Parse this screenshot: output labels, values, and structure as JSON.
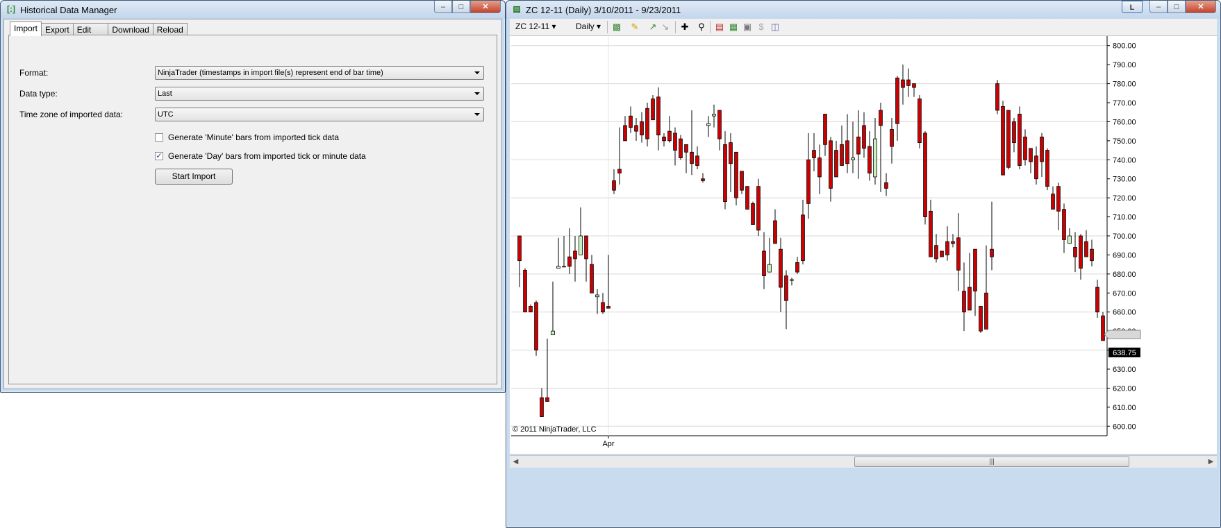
{
  "hdm": {
    "title": "Historical Data Manager",
    "tabs": [
      "Import",
      "Export",
      "Edit",
      "Download",
      "Reload"
    ],
    "format_label": "Format:",
    "format_value": "NinjaTrader (timestamps in import file(s) represent end of bar time)",
    "datatype_label": "Data type:",
    "datatype_value": "Last",
    "timezone_label": "Time zone of imported data:",
    "timezone_value": "UTC",
    "gen_minute_label": "Generate 'Minute' bars from imported tick data",
    "gen_minute_checked": false,
    "gen_day_label": "Generate 'Day' bars from imported tick or minute data",
    "gen_day_checked": true,
    "start_button": "Start Import"
  },
  "chart_window": {
    "title": "ZC 12-11 (Daily)  3/10/2011 - 9/23/2011",
    "link_button": "L",
    "toolbar": {
      "instrument": "ZC 12-11",
      "interval": "Daily"
    },
    "copyright": "© 2011 NinjaTrader, LLC"
  },
  "chart_data": {
    "type": "candlestick",
    "title": "ZC 12-11 (Daily)",
    "ylim": [
      595,
      805
    ],
    "y_ticks": [
      "800.00",
      "790.00",
      "780.00",
      "770.00",
      "760.00",
      "750.00",
      "740.00",
      "730.00",
      "720.00",
      "710.00",
      "700.00",
      "690.00",
      "680.00",
      "670.00",
      "660.00",
      "650.00",
      "640.00",
      "630.00",
      "620.00",
      "610.00",
      "600.00"
    ],
    "y_tick_values": [
      800,
      790,
      780,
      770,
      760,
      750,
      740,
      730,
      720,
      710,
      700,
      690,
      680,
      670,
      660,
      650,
      640,
      630,
      620,
      610,
      600
    ],
    "x_labels": [
      {
        "label": "Apr",
        "index": 16
      }
    ],
    "last_price": "638.75",
    "last_price_value": 638.75,
    "colors": {
      "up": "#c8f0c0",
      "down": "#cc0000",
      "outline": "#000000"
    },
    "candles": [
      [
        700,
        700,
        687,
        673
      ],
      [
        682,
        683,
        660,
        665
      ],
      [
        663,
        664,
        660,
        663
      ],
      [
        665,
        666,
        640,
        637
      ],
      [
        615,
        620,
        605,
        610
      ],
      [
        615,
        646,
        613,
        646
      ],
      [
        648,
        676,
        650,
        684
      ],
      [
        683,
        699,
        684,
        684
      ],
      [
        684,
        700,
        684,
        685
      ],
      [
        689,
        704,
        684,
        680
      ],
      [
        692,
        700,
        688,
        676
      ],
      [
        690,
        715,
        700,
        700
      ],
      [
        700,
        700,
        688,
        676
      ],
      [
        685,
        690,
        670,
        681
      ],
      [
        668,
        672,
        669,
        659
      ],
      [
        665,
        670,
        660,
        659
      ],
      [
        663,
        690,
        662,
        662
      ],
      [
        729,
        735,
        724,
        722
      ],
      [
        735,
        757,
        733,
        727
      ],
      [
        758,
        763,
        750,
        753
      ],
      [
        763,
        768,
        757,
        754
      ],
      [
        758,
        762,
        755,
        750
      ],
      [
        760,
        765,
        753,
        749
      ],
      [
        767,
        770,
        751,
        747
      ],
      [
        772,
        774,
        761,
        771
      ],
      [
        773,
        778,
        753,
        745
      ],
      [
        752,
        754,
        750,
        747
      ],
      [
        755,
        763,
        750,
        749
      ],
      [
        754,
        757,
        745,
        737
      ],
      [
        751,
        753,
        741,
        740
      ],
      [
        748,
        748,
        744,
        733
      ],
      [
        744,
        766,
        738,
        732
      ],
      [
        742,
        747,
        737,
        735
      ],
      [
        730,
        733,
        729,
        728
      ],
      [
        758,
        763,
        759,
        752
      ],
      [
        763,
        769,
        764,
        757
      ],
      [
        766,
        766,
        751,
        745
      ],
      [
        748,
        755,
        718,
        714
      ],
      [
        749,
        754,
        738,
        723
      ],
      [
        744,
        743,
        720,
        716
      ],
      [
        734,
        734,
        724,
        722
      ],
      [
        726,
        726,
        714,
        716
      ],
      [
        717,
        718,
        706,
        710
      ],
      [
        726,
        730,
        703,
        700
      ],
      [
        692,
        702,
        679,
        672
      ],
      [
        681,
        699,
        685,
        684
      ],
      [
        708,
        714,
        696,
        698
      ],
      [
        693,
        699,
        673,
        660
      ],
      [
        679,
        682,
        666,
        651
      ],
      [
        677,
        678,
        677,
        674
      ],
      [
        686,
        689,
        681,
        680
      ],
      [
        711,
        719,
        687,
        685
      ],
      [
        740,
        754,
        717,
        709
      ],
      [
        745,
        754,
        741,
        734
      ],
      [
        741,
        748,
        731,
        722
      ],
      [
        764,
        763,
        748,
        742
      ],
      [
        750,
        752,
        725,
        718
      ],
      [
        745,
        750,
        731,
        733
      ],
      [
        748,
        758,
        737,
        741
      ],
      [
        750,
        764,
        738,
        733
      ],
      [
        740,
        760,
        741,
        733
      ],
      [
        752,
        766,
        743,
        730
      ],
      [
        758,
        765,
        746,
        741
      ],
      [
        747,
        755,
        733,
        729
      ],
      [
        731,
        762,
        751,
        727
      ],
      [
        766,
        770,
        758,
        723
      ],
      [
        728,
        733,
        725,
        721
      ],
      [
        756,
        762,
        747,
        738
      ],
      [
        783,
        784,
        759,
        750
      ],
      [
        782,
        790,
        778,
        769
      ],
      [
        782,
        788,
        779,
        773
      ],
      [
        780,
        780,
        778,
        773
      ],
      [
        772,
        774,
        749,
        746
      ],
      [
        754,
        755,
        710,
        706
      ],
      [
        713,
        719,
        689,
        689
      ],
      [
        695,
        701,
        688,
        686
      ],
      [
        692,
        692,
        689,
        690
      ],
      [
        697,
        705,
        690,
        687
      ],
      [
        697,
        701,
        696,
        694
      ],
      [
        699,
        712,
        682,
        671
      ],
      [
        671,
        686,
        660,
        650
      ],
      [
        673,
        691,
        661,
        672
      ],
      [
        693,
        691,
        671,
        658
      ],
      [
        663,
        660,
        650,
        649
      ],
      [
        670,
        695,
        651,
        678
      ],
      [
        693,
        718,
        689,
        682
      ],
      [
        780,
        782,
        766,
        764
      ],
      [
        768,
        771,
        732,
        734
      ],
      [
        766,
        765,
        736,
        735
      ],
      [
        760,
        762,
        749,
        744
      ],
      [
        764,
        768,
        737,
        735
      ],
      [
        752,
        756,
        740,
        737
      ],
      [
        746,
        746,
        739,
        733
      ],
      [
        742,
        747,
        730,
        727
      ],
      [
        752,
        754,
        739,
        731
      ],
      [
        745,
        746,
        726,
        724
      ],
      [
        722,
        726,
        714,
        714
      ],
      [
        726,
        728,
        713,
        703
      ],
      [
        714,
        717,
        698,
        691
      ],
      [
        696,
        704,
        700,
        699
      ],
      [
        694,
        702,
        689,
        681
      ],
      [
        700,
        701,
        683,
        677
      ],
      [
        697,
        703,
        689,
        692
      ],
      [
        693,
        698,
        687,
        684
      ],
      [
        673,
        677,
        660,
        657
      ],
      [
        658,
        660,
        645,
        645
      ]
    ]
  }
}
